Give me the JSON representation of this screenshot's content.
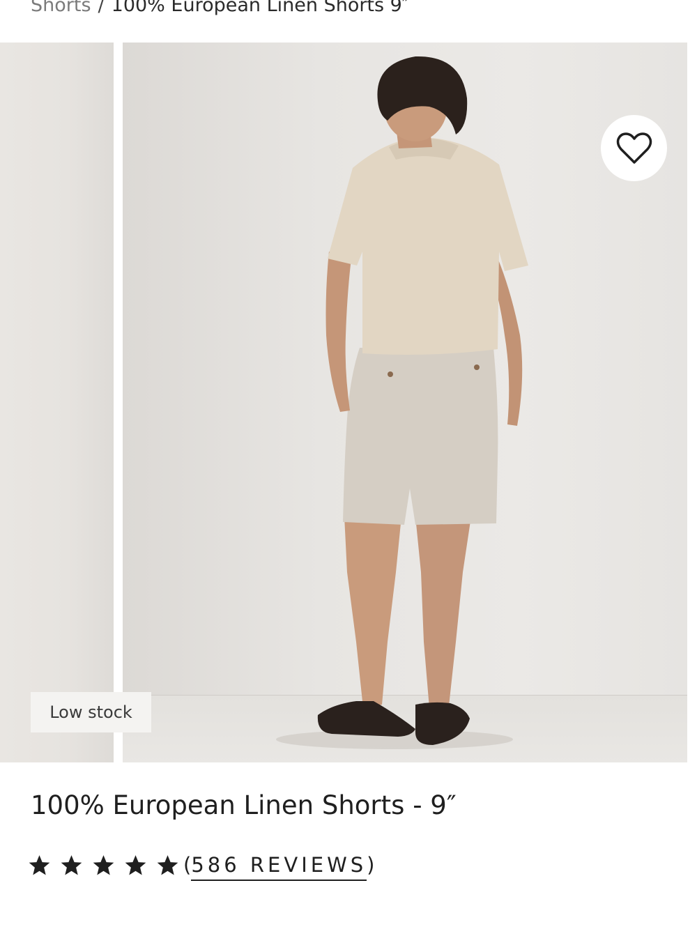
{
  "breadcrumb": {
    "parent": "Shorts",
    "separator": "/",
    "current": "100% European Linen Shorts 9″"
  },
  "gallery": {
    "wishlist_icon": "heart-outline-icon",
    "badge": "Low stock"
  },
  "product": {
    "title": "100% European Linen Shorts - 9″",
    "rating_stars": 5,
    "review_count_label": "586 REVIEWS"
  },
  "colors": {
    "text": "#1f1f1f",
    "muted": "#7b7b7b",
    "badge_bg": "#f4f3f1"
  }
}
